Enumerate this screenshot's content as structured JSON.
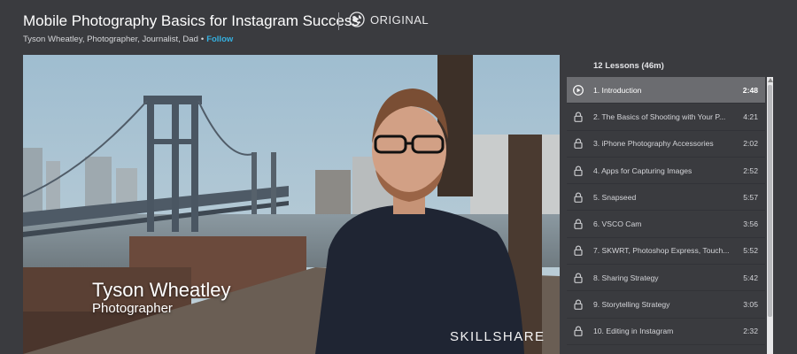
{
  "course": {
    "title": "Mobile Photography Basics for Instagram Success",
    "badge_label": "ORIGINAL",
    "author_desc": "Tyson Wheatley, Photographer, Journalist, Dad",
    "separator": "•",
    "follow_label": "Follow"
  },
  "video": {
    "lower_third_name": "Tyson Wheatley",
    "lower_third_role": "Photographer",
    "watermark": "SKILLSHARE"
  },
  "lessons": {
    "header": "12 Lessons (46m)",
    "active_index": 0,
    "items": [
      {
        "title": "1. Introduction",
        "duration": "2:48",
        "icon": "play-icon"
      },
      {
        "title": "2. The Basics of Shooting with Your P...",
        "duration": "4:21",
        "icon": "lock-icon"
      },
      {
        "title": "3. iPhone Photography Accessories",
        "duration": "2:02",
        "icon": "lock-icon"
      },
      {
        "title": "4. Apps for Capturing Images",
        "duration": "2:52",
        "icon": "lock-icon"
      },
      {
        "title": "5. Snapseed",
        "duration": "5:57",
        "icon": "lock-icon"
      },
      {
        "title": "6. VSCO Cam",
        "duration": "3:56",
        "icon": "lock-icon"
      },
      {
        "title": "7. SKWRT, Photoshop Express, Touch...",
        "duration": "5:52",
        "icon": "lock-icon"
      },
      {
        "title": "8. Sharing Strategy",
        "duration": "5:42",
        "icon": "lock-icon"
      },
      {
        "title": "9. Storytelling Strategy",
        "duration": "3:05",
        "icon": "lock-icon"
      },
      {
        "title": "10. Editing in Instagram",
        "duration": "2:32",
        "icon": "lock-icon"
      }
    ]
  },
  "colors": {
    "background": "#3a3b3f",
    "accent_follow": "#35b0e0",
    "active_row": "#6b6c70"
  }
}
